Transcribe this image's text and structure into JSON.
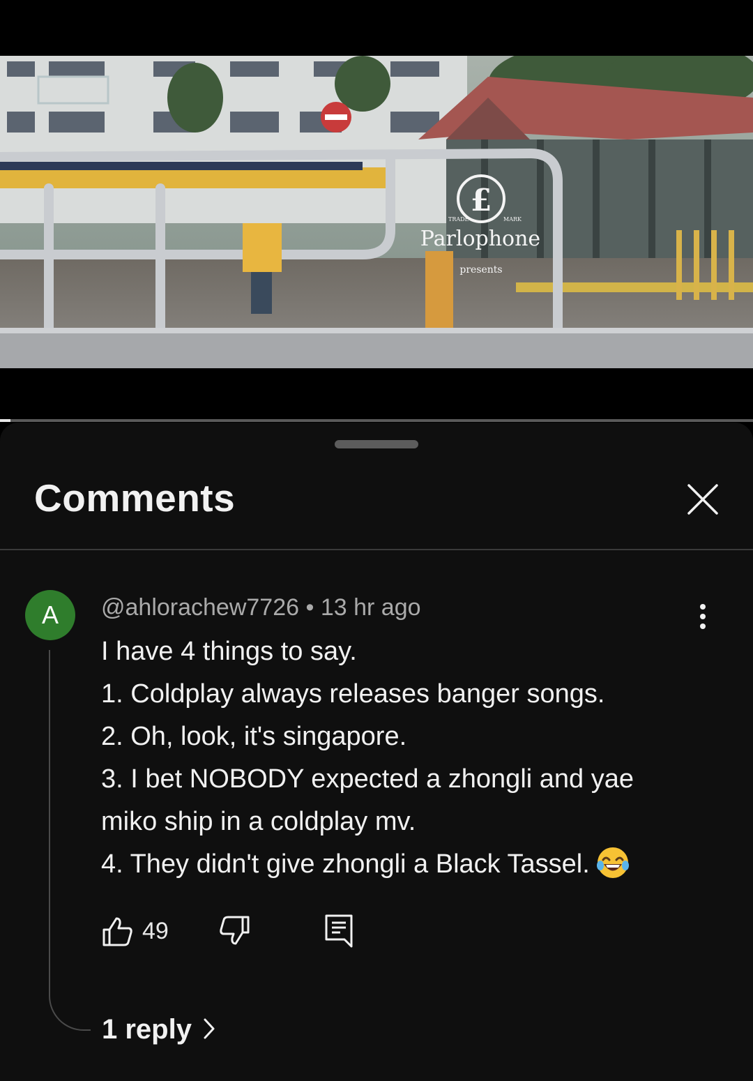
{
  "video": {
    "overlay_trade": "TRADE",
    "overlay_mark": "MARK",
    "overlay_logo_text": "Parlophone",
    "overlay_presents": "presents",
    "progress_fraction": 0.014
  },
  "comments_panel": {
    "title": "Comments"
  },
  "comment": {
    "avatar_letter": "A",
    "avatar_color": "#2f7d2c",
    "author": "@ahlorachew7726",
    "separator": "•",
    "time": "13 hr ago",
    "lines": [
      "I have 4 things to say.",
      "1. Coldplay always releases banger songs.",
      "2. Oh, look, it's singapore.",
      "3. I bet NOBODY expected a zhongli and yae",
      "miko ship in a coldplay mv.",
      "4. They didn't give zhongli a Black Tassel."
    ],
    "emoji": "face-with-tears-of-joy",
    "likes": "49",
    "replies_label": "1 reply"
  },
  "icons": [
    "close-icon",
    "more-vert-icon",
    "thumb-up-icon",
    "thumb-down-icon",
    "reply-comment-icon",
    "chevron-right-icon"
  ]
}
